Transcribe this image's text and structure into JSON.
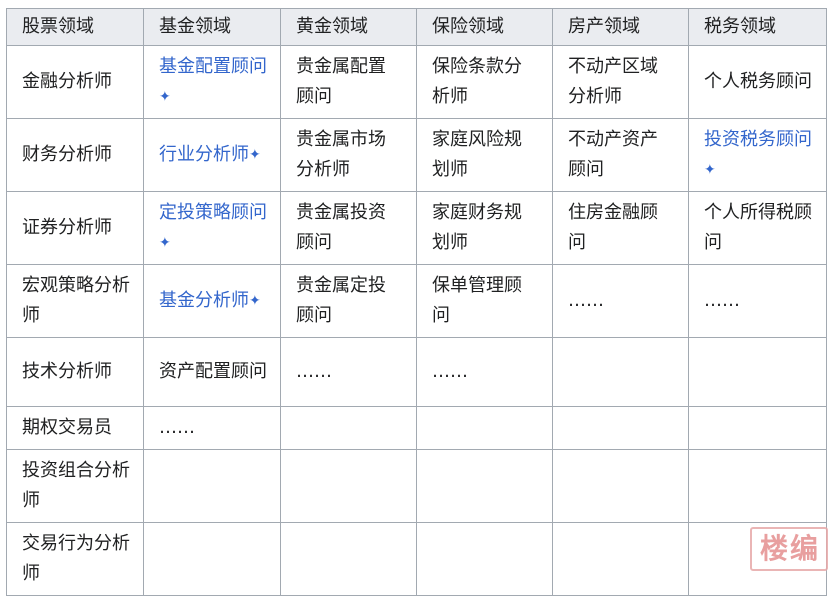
{
  "table": {
    "headers": [
      "股票领域",
      "基金领域",
      "黄金领域",
      "保险领域",
      "房产领域",
      "税务领域"
    ],
    "rows": [
      [
        {
          "text": "金融分析师",
          "link": false
        },
        {
          "text": "基金配置顾问",
          "link": true,
          "star": true
        },
        {
          "text": "贵金属配置顾问",
          "link": false
        },
        {
          "text": "保险条款分析师",
          "link": false
        },
        {
          "text": "不动产区域分析师",
          "link": false
        },
        {
          "text": "个人税务顾问",
          "link": false
        }
      ],
      [
        {
          "text": "财务分析师",
          "link": false
        },
        {
          "text": "行业分析师",
          "link": true,
          "star": true
        },
        {
          "text": "贵金属市场分析师",
          "link": false
        },
        {
          "text": "家庭风险规划师",
          "link": false
        },
        {
          "text": "不动产资产顾问",
          "link": false
        },
        {
          "text": "投资税务顾问",
          "link": true,
          "star": true
        }
      ],
      [
        {
          "text": "证券分析师",
          "link": false
        },
        {
          "text": "定投策略顾问",
          "link": true,
          "star": true
        },
        {
          "text": "贵金属投资顾问",
          "link": false
        },
        {
          "text": "家庭财务规划师",
          "link": false
        },
        {
          "text": "住房金融顾问",
          "link": false
        },
        {
          "text": "个人所得税顾问",
          "link": false
        }
      ],
      [
        {
          "text": "宏观策略分析师",
          "link": false
        },
        {
          "text": "基金分析师",
          "link": true,
          "star": true
        },
        {
          "text": "贵金属定投顾问",
          "link": false
        },
        {
          "text": "保单管理顾问",
          "link": false
        },
        {
          "text": "……",
          "link": false
        },
        {
          "text": "……",
          "link": false
        }
      ],
      [
        {
          "text": "技术分析师",
          "link": false
        },
        {
          "text": "资产配置顾问",
          "link": false
        },
        {
          "text": "……",
          "link": false
        },
        {
          "text": "……",
          "link": false
        },
        {
          "text": "",
          "link": false
        },
        {
          "text": "",
          "link": false
        }
      ],
      [
        {
          "text": "期权交易员",
          "link": false
        },
        {
          "text": "……",
          "link": false
        },
        {
          "text": "",
          "link": false
        },
        {
          "text": "",
          "link": false
        },
        {
          "text": "",
          "link": false
        },
        {
          "text": "",
          "link": false
        }
      ],
      [
        {
          "text": "投资组合分析师",
          "link": false
        },
        {
          "text": "",
          "link": false
        },
        {
          "text": "",
          "link": false
        },
        {
          "text": "",
          "link": false
        },
        {
          "text": "",
          "link": false
        },
        {
          "text": "",
          "link": false
        }
      ],
      [
        {
          "text": "交易行为分析师",
          "link": false
        },
        {
          "text": "",
          "link": false
        },
        {
          "text": "",
          "link": false
        },
        {
          "text": "",
          "link": false
        },
        {
          "text": "",
          "link": false
        },
        {
          "text": "",
          "link": false
        }
      ]
    ]
  },
  "star_glyph": "✦",
  "colors": {
    "link": "#3366cc",
    "header_bg": "#eaecf0",
    "border": "#a2a9b1",
    "text": "#202122",
    "seal": "#e58f8f"
  },
  "seal": {
    "glyphs": [
      "楼",
      "编"
    ]
  },
  "icons": {
    "external_link_marker": "sparkle-icon"
  }
}
